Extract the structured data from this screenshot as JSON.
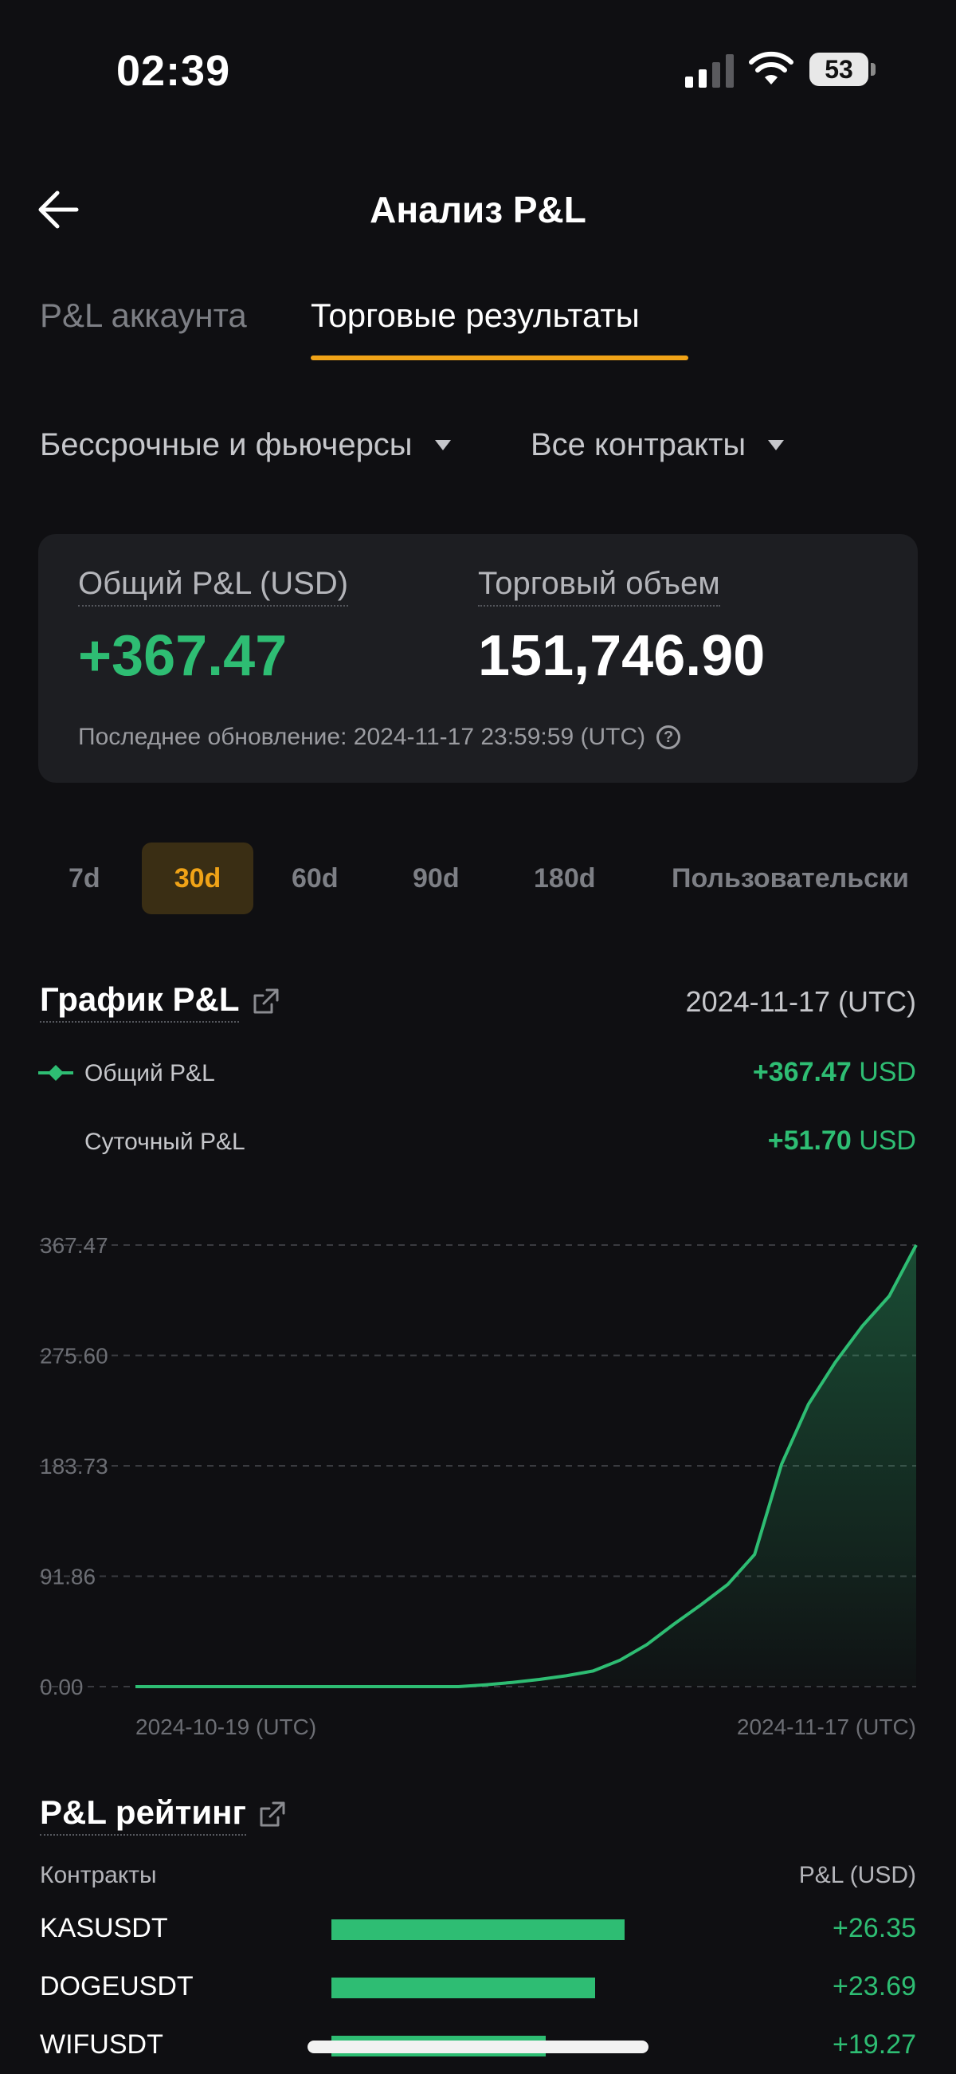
{
  "status_bar": {
    "time": "02:39",
    "battery": "53"
  },
  "header": {
    "title": "Анализ P&L"
  },
  "tabs": [
    "P&L аккаунта",
    "Торговые результаты"
  ],
  "filters": {
    "product": "Бессрочные и фьючерсы",
    "contracts": "Все контракты"
  },
  "summary": {
    "pnl_label": "Общий P&L (USD)",
    "pnl_value": "+367.47",
    "volume_label": "Торговый объем",
    "volume_value": "151,746.90",
    "last_update": "Последнее обновление: 2024-11-17 23:59:59 (UTC)"
  },
  "periods": [
    "7d",
    "30d",
    "60d",
    "90d",
    "180d",
    "Пользовательски"
  ],
  "pnl_chart": {
    "title": "График P&L",
    "date": "2024-11-17 (UTC)",
    "legend": [
      {
        "label": "Общий P&L",
        "value": "+367.47",
        "unit": "USD"
      },
      {
        "label": "Суточный P&L",
        "value": "+51.70",
        "unit": "USD"
      }
    ],
    "colors": {
      "line": "#2ebd73",
      "grid": "#3a3b40"
    }
  },
  "chart_data": {
    "type": "area",
    "ylim": [
      0,
      367.47
    ],
    "yticks": [
      "367.47",
      "275.60",
      "183.73",
      "91.86",
      "0.00"
    ],
    "xlabels": [
      "2024-10-19 (UTC)",
      "2024-11-17 (UTC)"
    ],
    "series": [
      {
        "values": [
          0,
          0,
          0,
          0,
          0,
          0,
          0,
          0,
          0,
          0,
          0,
          0,
          0,
          1.5,
          3.5,
          6,
          9,
          13,
          22,
          35,
          52,
          68,
          85,
          110,
          185,
          235,
          270,
          300,
          325,
          367.47
        ]
      }
    ]
  },
  "ranking": {
    "title": "P&L рейтинг",
    "col_contracts": "Контракты",
    "col_pnl": "P&L (USD)",
    "rows": [
      {
        "name": "KASUSDT",
        "value": "+26.35",
        "amount": 26.35
      },
      {
        "name": "DOGEUSDT",
        "value": "+23.69",
        "amount": 23.69
      },
      {
        "name": "WIFUSDT",
        "value": "+19.27",
        "amount": 19.27
      }
    ]
  }
}
